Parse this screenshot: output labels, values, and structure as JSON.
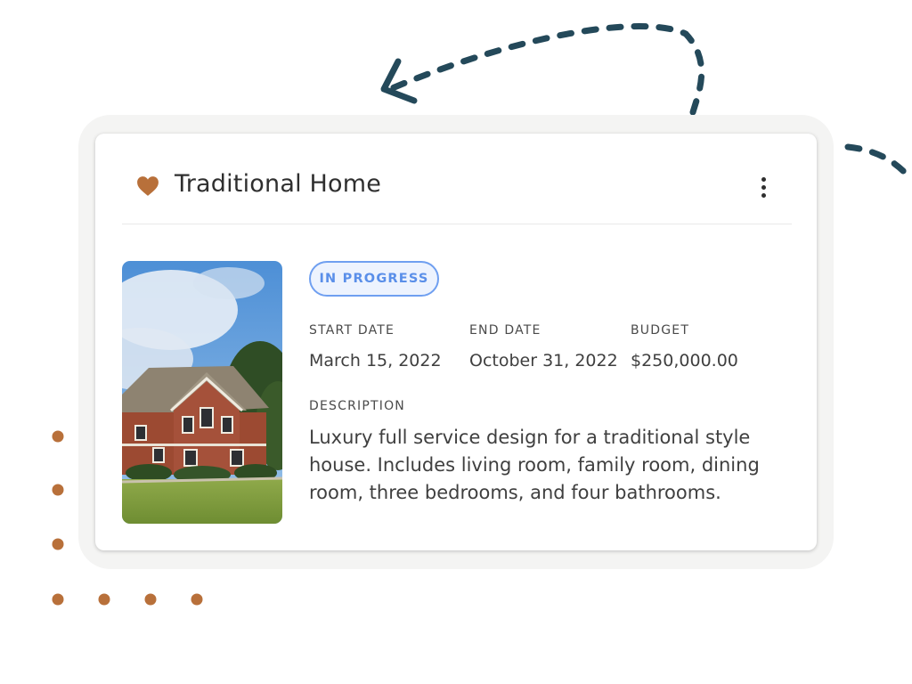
{
  "card": {
    "title": "Traditional Home",
    "status": "IN PROGRESS",
    "fields": {
      "start_date_label": "START DATE",
      "start_date_value": "March 15, 2022",
      "end_date_label": "END DATE",
      "end_date_value": "October 31, 2022",
      "budget_label": "BUDGET",
      "budget_value": "$250,000.00"
    },
    "description_label": "DESCRIPTION",
    "description": "Luxury full service design for a traditional style house. Includes living room, family room, dining room, three bedrooms, and four bathrooms."
  },
  "icons": {
    "heart": "heart-icon",
    "menu": "more-vertical-icon"
  },
  "colors": {
    "accent": "#b8703a",
    "status_blue": "#5a8fe9",
    "status_bg": "#edf3fe",
    "arrow": "#24495a"
  }
}
